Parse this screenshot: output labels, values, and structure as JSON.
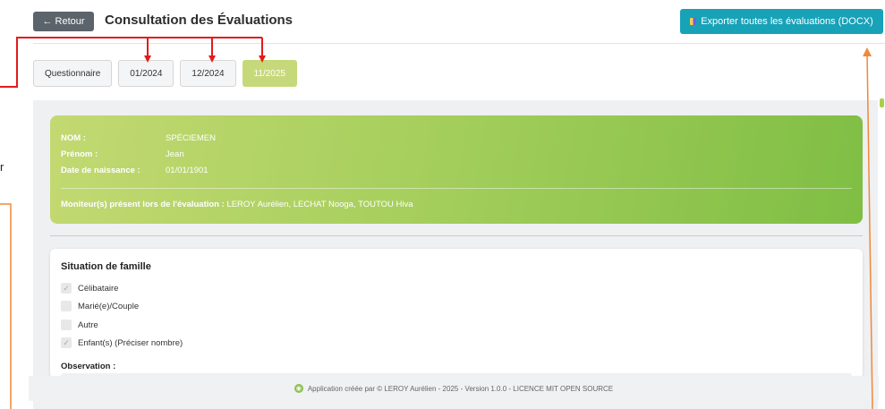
{
  "header": {
    "back_label": "← Retour",
    "title": "Consultation des Évaluations",
    "export_label": "Exporter toutes les évaluations (DOCX)",
    "export_icon": "book-icon"
  },
  "tabs": [
    {
      "label": "Questionnaire",
      "active": false
    },
    {
      "label": "01/2024",
      "active": false
    },
    {
      "label": "12/2024",
      "active": false
    },
    {
      "label": "11/2025",
      "active": true
    }
  ],
  "identity": {
    "nom_label": "NOM :",
    "nom_value": "SPÉCIEMEN",
    "prenom_label": "Prénom :",
    "prenom_value": "Jean",
    "dob_label": "Date de naissance :",
    "dob_value": "01/01/1901",
    "monitors_label": "Moniteur(s) présent lors de l'évaluation :",
    "monitors_value": "LEROY Aurélien, LECHAT Nooga, TOUTOU Hiva"
  },
  "situation": {
    "title": "Situation de famille",
    "options": [
      {
        "label": "Célibataire",
        "checked": true
      },
      {
        "label": "Marié(e)/Couple",
        "checked": false
      },
      {
        "label": "Autre",
        "checked": false
      },
      {
        "label": "Enfant(s) (Préciser nombre)",
        "checked": true
      }
    ],
    "observation_label": "Observation :"
  },
  "footer": {
    "text": "Application créée par © LEROY Aurélien - 2025 - Version 1.0.0 - LICENCE MIT OPEN SOURCE",
    "icon": "leaf-icon"
  },
  "annotations": {
    "side_text": "r",
    "arrow_color": "#e31b1b",
    "export_arrow_color": "#f0883a"
  },
  "colors": {
    "accent_green": "#a6cf5d",
    "export_teal": "#17a2b8",
    "back_gray": "#5b636b"
  }
}
